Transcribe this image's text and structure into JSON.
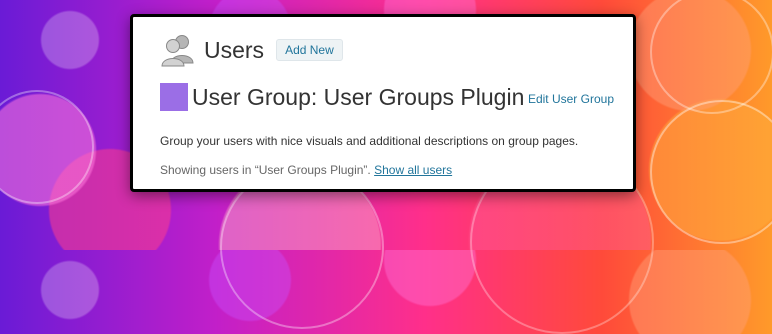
{
  "header": {
    "title": "Users",
    "add_new_label": "Add New"
  },
  "group": {
    "title": "User Group: User Groups Plugin",
    "edit_label": "Edit User Group",
    "color": "#9b6ee6"
  },
  "content": {
    "description": "Group your users with nice visuals and additional descriptions on group pages.",
    "showing_text": "Showing users in “User Groups Plugin”. ",
    "show_all_label": "Show all users"
  },
  "colors": {
    "link": "#21759b",
    "background_gradient": [
      "#6a1bd6",
      "#c21fc9",
      "#ff2f8a",
      "#ff4a3a",
      "#ff9a2a"
    ]
  },
  "icons": {
    "users": "users-icon"
  }
}
